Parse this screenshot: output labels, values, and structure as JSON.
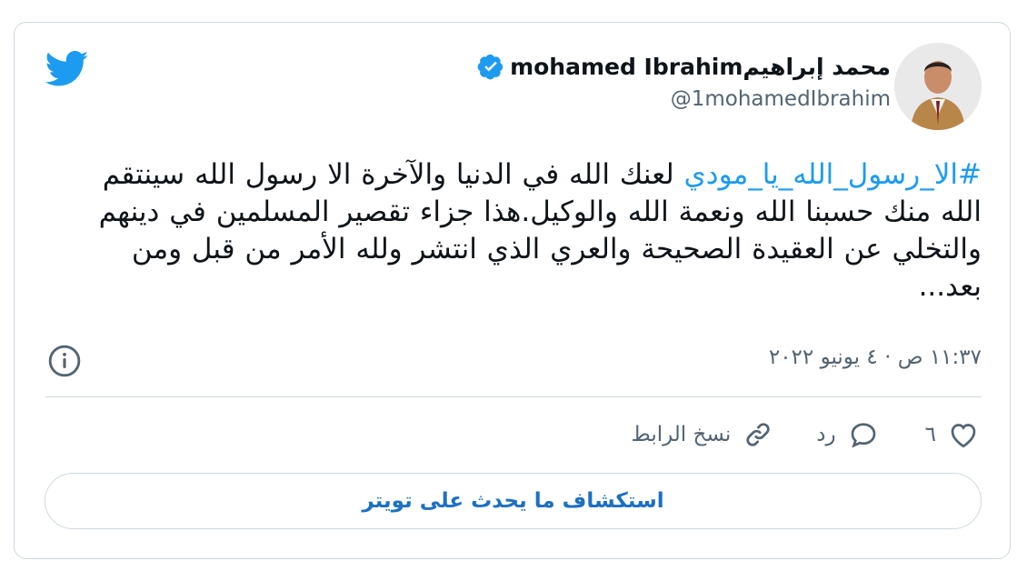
{
  "author": {
    "display_name": "محمد إبراهيمmohamed Ibrahim",
    "handle": "@1mohamedIbrahim",
    "verified": true
  },
  "tweet": {
    "hashtag": "#الا_رسول_الله_يا_مودي",
    "body": " لعنك الله في الدنيا والآخرة الا رسول الله سينتقم الله منك حسبنا الله ونعمة الله والوكيل.هذا جزاء تقصير المسلمين في دينهم والتخلي عن العقيدة الصحيحة والعري الذي انتشر ولله الأمر من قبل ومن بعد...",
    "timestamp": "١١:٣٧ ص · ٤ يونيو ٢٠٢٢"
  },
  "actions": {
    "like_count": "٦",
    "reply_label": "رد",
    "copy_link_label": "نسخ الرابط"
  },
  "explore_button_label": "استكشاف ما يحدث على تويتر",
  "colors": {
    "accent": "#1d9bf0",
    "button_text": "#1d70c2",
    "secondary_text": "#536471",
    "border": "#cfd9de"
  },
  "icons": [
    "twitter-bird-icon",
    "verified-badge-icon",
    "info-icon",
    "heart-icon",
    "reply-bubble-icon",
    "link-icon"
  ]
}
